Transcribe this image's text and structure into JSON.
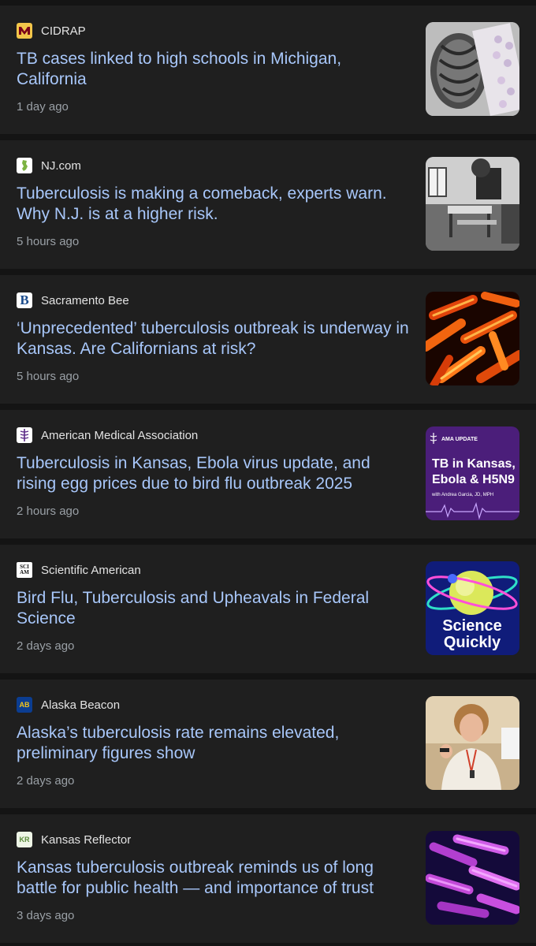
{
  "articles": [
    {
      "source": "CIDRAP",
      "headline": "TB cases linked to high schools in Michigan, California",
      "time": "1 day ago",
      "logo_icon": "university-of-minnesota-logo-icon"
    },
    {
      "source": "NJ.com",
      "headline": "Tuberculosis is making a comeback, experts warn. Why N.J. is at a higher risk.",
      "time": "5 hours ago",
      "logo_icon": "nj-state-logo-icon"
    },
    {
      "source": "Sacramento Bee",
      "headline": "‘Unprecedented’ tuberculosis outbreak is underway in Kansas. Are Californians at risk?",
      "time": "5 hours ago",
      "logo_icon": "sacramento-bee-logo-icon",
      "logo_text": "B"
    },
    {
      "source": "American Medical Association",
      "headline": "Tuberculosis in Kansas, Ebola virus update, and rising egg prices due to bird flu outbreak 2025",
      "time": "2 hours ago",
      "logo_icon": "ama-caduceus-logo-icon",
      "thumb_text": {
        "tag": "AMA UPDATE",
        "title_1": "TB in Kansas,",
        "title_2": "Ebola & H5N9",
        "byline": "with Andrea Garcia, JD, MPH"
      }
    },
    {
      "source": "Scientific American",
      "headline": "Bird Flu, Tuberculosis and Upheavals in Federal Science",
      "time": "2 days ago",
      "logo_icon": "scientific-american-logo-icon",
      "logo_text": "SCI AM",
      "thumb_text": {
        "line_1": "Science",
        "line_2": "Quickly"
      }
    },
    {
      "source": "Alaska Beacon",
      "headline": "Alaska’s tuberculosis rate remains elevated, preliminary figures show",
      "time": "2 days ago",
      "logo_icon": "alaska-beacon-logo-icon",
      "logo_text": "AB"
    },
    {
      "source": "Kansas Reflector",
      "headline": "Kansas tuberculosis outbreak reminds us of long battle for public health — and importance of trust",
      "time": "3 days ago",
      "logo_icon": "kansas-reflector-logo-icon",
      "logo_text": "KR"
    }
  ],
  "colors": {
    "background": "#141414",
    "card": "#1f1f1f",
    "headline": "#a8c7fa",
    "source": "#e3e3e3",
    "time": "#9aa0a6"
  }
}
